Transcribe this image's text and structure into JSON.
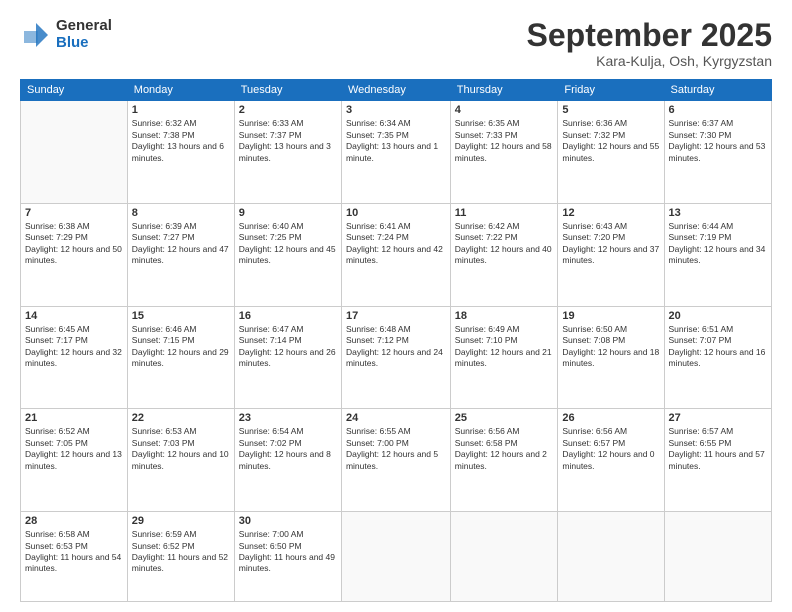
{
  "logo": {
    "general": "General",
    "blue": "Blue"
  },
  "header": {
    "month_title": "September 2025",
    "location": "Kara-Kulja, Osh, Kyrgyzstan"
  },
  "weekdays": [
    "Sunday",
    "Monday",
    "Tuesday",
    "Wednesday",
    "Thursday",
    "Friday",
    "Saturday"
  ],
  "weeks": [
    [
      {
        "num": "",
        "sunrise": "",
        "sunset": "",
        "daylight": "",
        "empty": true
      },
      {
        "num": "1",
        "sunrise": "Sunrise: 6:32 AM",
        "sunset": "Sunset: 7:38 PM",
        "daylight": "Daylight: 13 hours and 6 minutes.",
        "empty": false
      },
      {
        "num": "2",
        "sunrise": "Sunrise: 6:33 AM",
        "sunset": "Sunset: 7:37 PM",
        "daylight": "Daylight: 13 hours and 3 minutes.",
        "empty": false
      },
      {
        "num": "3",
        "sunrise": "Sunrise: 6:34 AM",
        "sunset": "Sunset: 7:35 PM",
        "daylight": "Daylight: 13 hours and 1 minute.",
        "empty": false
      },
      {
        "num": "4",
        "sunrise": "Sunrise: 6:35 AM",
        "sunset": "Sunset: 7:33 PM",
        "daylight": "Daylight: 12 hours and 58 minutes.",
        "empty": false
      },
      {
        "num": "5",
        "sunrise": "Sunrise: 6:36 AM",
        "sunset": "Sunset: 7:32 PM",
        "daylight": "Daylight: 12 hours and 55 minutes.",
        "empty": false
      },
      {
        "num": "6",
        "sunrise": "Sunrise: 6:37 AM",
        "sunset": "Sunset: 7:30 PM",
        "daylight": "Daylight: 12 hours and 53 minutes.",
        "empty": false
      }
    ],
    [
      {
        "num": "7",
        "sunrise": "Sunrise: 6:38 AM",
        "sunset": "Sunset: 7:29 PM",
        "daylight": "Daylight: 12 hours and 50 minutes.",
        "empty": false
      },
      {
        "num": "8",
        "sunrise": "Sunrise: 6:39 AM",
        "sunset": "Sunset: 7:27 PM",
        "daylight": "Daylight: 12 hours and 47 minutes.",
        "empty": false
      },
      {
        "num": "9",
        "sunrise": "Sunrise: 6:40 AM",
        "sunset": "Sunset: 7:25 PM",
        "daylight": "Daylight: 12 hours and 45 minutes.",
        "empty": false
      },
      {
        "num": "10",
        "sunrise": "Sunrise: 6:41 AM",
        "sunset": "Sunset: 7:24 PM",
        "daylight": "Daylight: 12 hours and 42 minutes.",
        "empty": false
      },
      {
        "num": "11",
        "sunrise": "Sunrise: 6:42 AM",
        "sunset": "Sunset: 7:22 PM",
        "daylight": "Daylight: 12 hours and 40 minutes.",
        "empty": false
      },
      {
        "num": "12",
        "sunrise": "Sunrise: 6:43 AM",
        "sunset": "Sunset: 7:20 PM",
        "daylight": "Daylight: 12 hours and 37 minutes.",
        "empty": false
      },
      {
        "num": "13",
        "sunrise": "Sunrise: 6:44 AM",
        "sunset": "Sunset: 7:19 PM",
        "daylight": "Daylight: 12 hours and 34 minutes.",
        "empty": false
      }
    ],
    [
      {
        "num": "14",
        "sunrise": "Sunrise: 6:45 AM",
        "sunset": "Sunset: 7:17 PM",
        "daylight": "Daylight: 12 hours and 32 minutes.",
        "empty": false
      },
      {
        "num": "15",
        "sunrise": "Sunrise: 6:46 AM",
        "sunset": "Sunset: 7:15 PM",
        "daylight": "Daylight: 12 hours and 29 minutes.",
        "empty": false
      },
      {
        "num": "16",
        "sunrise": "Sunrise: 6:47 AM",
        "sunset": "Sunset: 7:14 PM",
        "daylight": "Daylight: 12 hours and 26 minutes.",
        "empty": false
      },
      {
        "num": "17",
        "sunrise": "Sunrise: 6:48 AM",
        "sunset": "Sunset: 7:12 PM",
        "daylight": "Daylight: 12 hours and 24 minutes.",
        "empty": false
      },
      {
        "num": "18",
        "sunrise": "Sunrise: 6:49 AM",
        "sunset": "Sunset: 7:10 PM",
        "daylight": "Daylight: 12 hours and 21 minutes.",
        "empty": false
      },
      {
        "num": "19",
        "sunrise": "Sunrise: 6:50 AM",
        "sunset": "Sunset: 7:08 PM",
        "daylight": "Daylight: 12 hours and 18 minutes.",
        "empty": false
      },
      {
        "num": "20",
        "sunrise": "Sunrise: 6:51 AM",
        "sunset": "Sunset: 7:07 PM",
        "daylight": "Daylight: 12 hours and 16 minutes.",
        "empty": false
      }
    ],
    [
      {
        "num": "21",
        "sunrise": "Sunrise: 6:52 AM",
        "sunset": "Sunset: 7:05 PM",
        "daylight": "Daylight: 12 hours and 13 minutes.",
        "empty": false
      },
      {
        "num": "22",
        "sunrise": "Sunrise: 6:53 AM",
        "sunset": "Sunset: 7:03 PM",
        "daylight": "Daylight: 12 hours and 10 minutes.",
        "empty": false
      },
      {
        "num": "23",
        "sunrise": "Sunrise: 6:54 AM",
        "sunset": "Sunset: 7:02 PM",
        "daylight": "Daylight: 12 hours and 8 minutes.",
        "empty": false
      },
      {
        "num": "24",
        "sunrise": "Sunrise: 6:55 AM",
        "sunset": "Sunset: 7:00 PM",
        "daylight": "Daylight: 12 hours and 5 minutes.",
        "empty": false
      },
      {
        "num": "25",
        "sunrise": "Sunrise: 6:56 AM",
        "sunset": "Sunset: 6:58 PM",
        "daylight": "Daylight: 12 hours and 2 minutes.",
        "empty": false
      },
      {
        "num": "26",
        "sunrise": "Sunrise: 6:56 AM",
        "sunset": "Sunset: 6:57 PM",
        "daylight": "Daylight: 12 hours and 0 minutes.",
        "empty": false
      },
      {
        "num": "27",
        "sunrise": "Sunrise: 6:57 AM",
        "sunset": "Sunset: 6:55 PM",
        "daylight": "Daylight: 11 hours and 57 minutes.",
        "empty": false
      }
    ],
    [
      {
        "num": "28",
        "sunrise": "Sunrise: 6:58 AM",
        "sunset": "Sunset: 6:53 PM",
        "daylight": "Daylight: 11 hours and 54 minutes.",
        "empty": false
      },
      {
        "num": "29",
        "sunrise": "Sunrise: 6:59 AM",
        "sunset": "Sunset: 6:52 PM",
        "daylight": "Daylight: 11 hours and 52 minutes.",
        "empty": false
      },
      {
        "num": "30",
        "sunrise": "Sunrise: 7:00 AM",
        "sunset": "Sunset: 6:50 PM",
        "daylight": "Daylight: 11 hours and 49 minutes.",
        "empty": false
      },
      {
        "num": "",
        "sunrise": "",
        "sunset": "",
        "daylight": "",
        "empty": true
      },
      {
        "num": "",
        "sunrise": "",
        "sunset": "",
        "daylight": "",
        "empty": true
      },
      {
        "num": "",
        "sunrise": "",
        "sunset": "",
        "daylight": "",
        "empty": true
      },
      {
        "num": "",
        "sunrise": "",
        "sunset": "",
        "daylight": "",
        "empty": true
      }
    ]
  ]
}
